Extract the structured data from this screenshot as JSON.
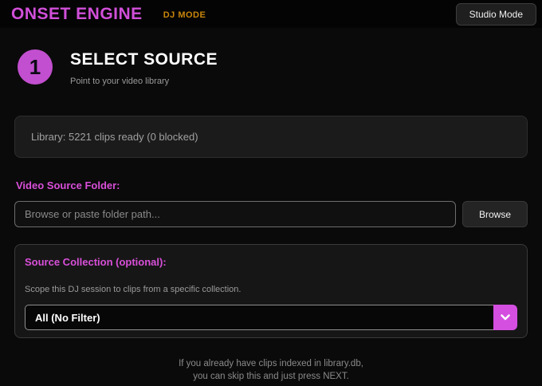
{
  "header": {
    "brand": "ONSET ENGINE",
    "mode_label": "DJ MODE",
    "studio_mode_button": "Studio Mode"
  },
  "step": {
    "number": "1",
    "title": "SELECT SOURCE",
    "subtitle": "Point to your video library"
  },
  "library_status": {
    "text": "Library: 5221 clips ready  (0 blocked)"
  },
  "source_folder": {
    "label": "Video Source Folder:",
    "placeholder": "Browse or paste folder path...",
    "value": "",
    "browse_button": "Browse"
  },
  "collection": {
    "label": "Source Collection (optional):",
    "description": "Scope this DJ session to clips from a specific collection.",
    "selected_option": "All (No Filter)"
  },
  "footer": {
    "line1": "If you already have clips indexed in library.db,",
    "line2": "you can skip this and just press NEXT."
  },
  "colors": {
    "brand_magenta": "#d14fd9",
    "accent_magenta": "#d94fd9",
    "mode_orange": "#c8860a",
    "step_circle": "#c24fcf",
    "chevron_button": "#d44fe0",
    "background": "#0a0a0a"
  },
  "icons": {
    "chevron_down": "chevron-down"
  }
}
